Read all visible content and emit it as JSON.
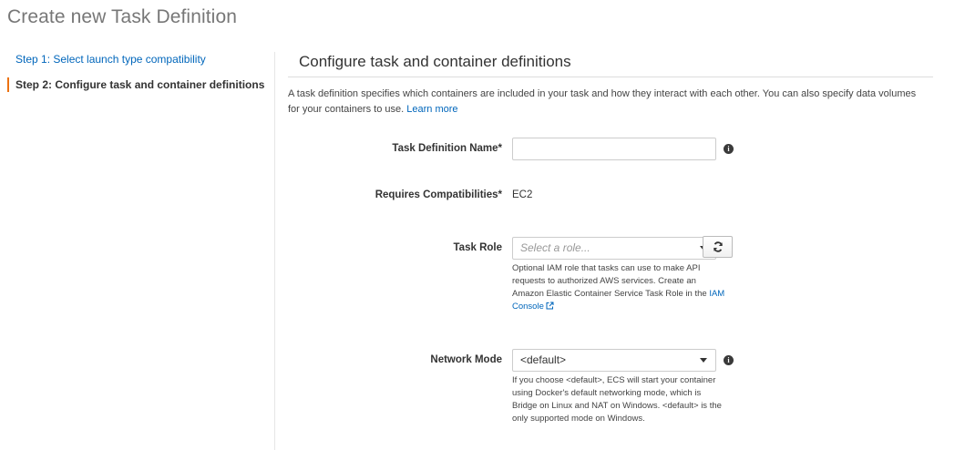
{
  "page": {
    "title": "Create new Task Definition"
  },
  "steps": [
    {
      "label": "Step 1: Select launch type compatibility",
      "state": "link"
    },
    {
      "label": "Step 2: Configure task and container definitions",
      "state": "active"
    }
  ],
  "section": {
    "title": "Configure task and container definitions",
    "description": "A task definition specifies which containers are included in your task and how they interact with each other. You can also specify data volumes for your containers to use.",
    "learn_more": "Learn more"
  },
  "form": {
    "task_definition_name": {
      "label": "Task Definition Name*",
      "value": ""
    },
    "requires_compatibilities": {
      "label": "Requires Compatibilities*",
      "value": "EC2"
    },
    "task_role": {
      "label": "Task Role",
      "placeholder": "Select a role...",
      "help_text": "Optional IAM role that tasks can use to make API requests to authorized AWS services. Create an Amazon Elastic Container Service Task Role in the",
      "help_link": "IAM Console"
    },
    "network_mode": {
      "label": "Network Mode",
      "value": "<default>",
      "help_text": "If you choose <default>, ECS will start your container using Docker's default networking mode, which is Bridge on Linux and NAT on Windows. <default> is the only supported mode on Windows."
    }
  },
  "icons": {
    "info": "info-icon",
    "refresh": "refresh-icon",
    "external_link": "external-link-icon",
    "caret": "chevron-down-icon"
  },
  "colors": {
    "link": "#0066bb",
    "active_step_marker": "#ec7211"
  }
}
